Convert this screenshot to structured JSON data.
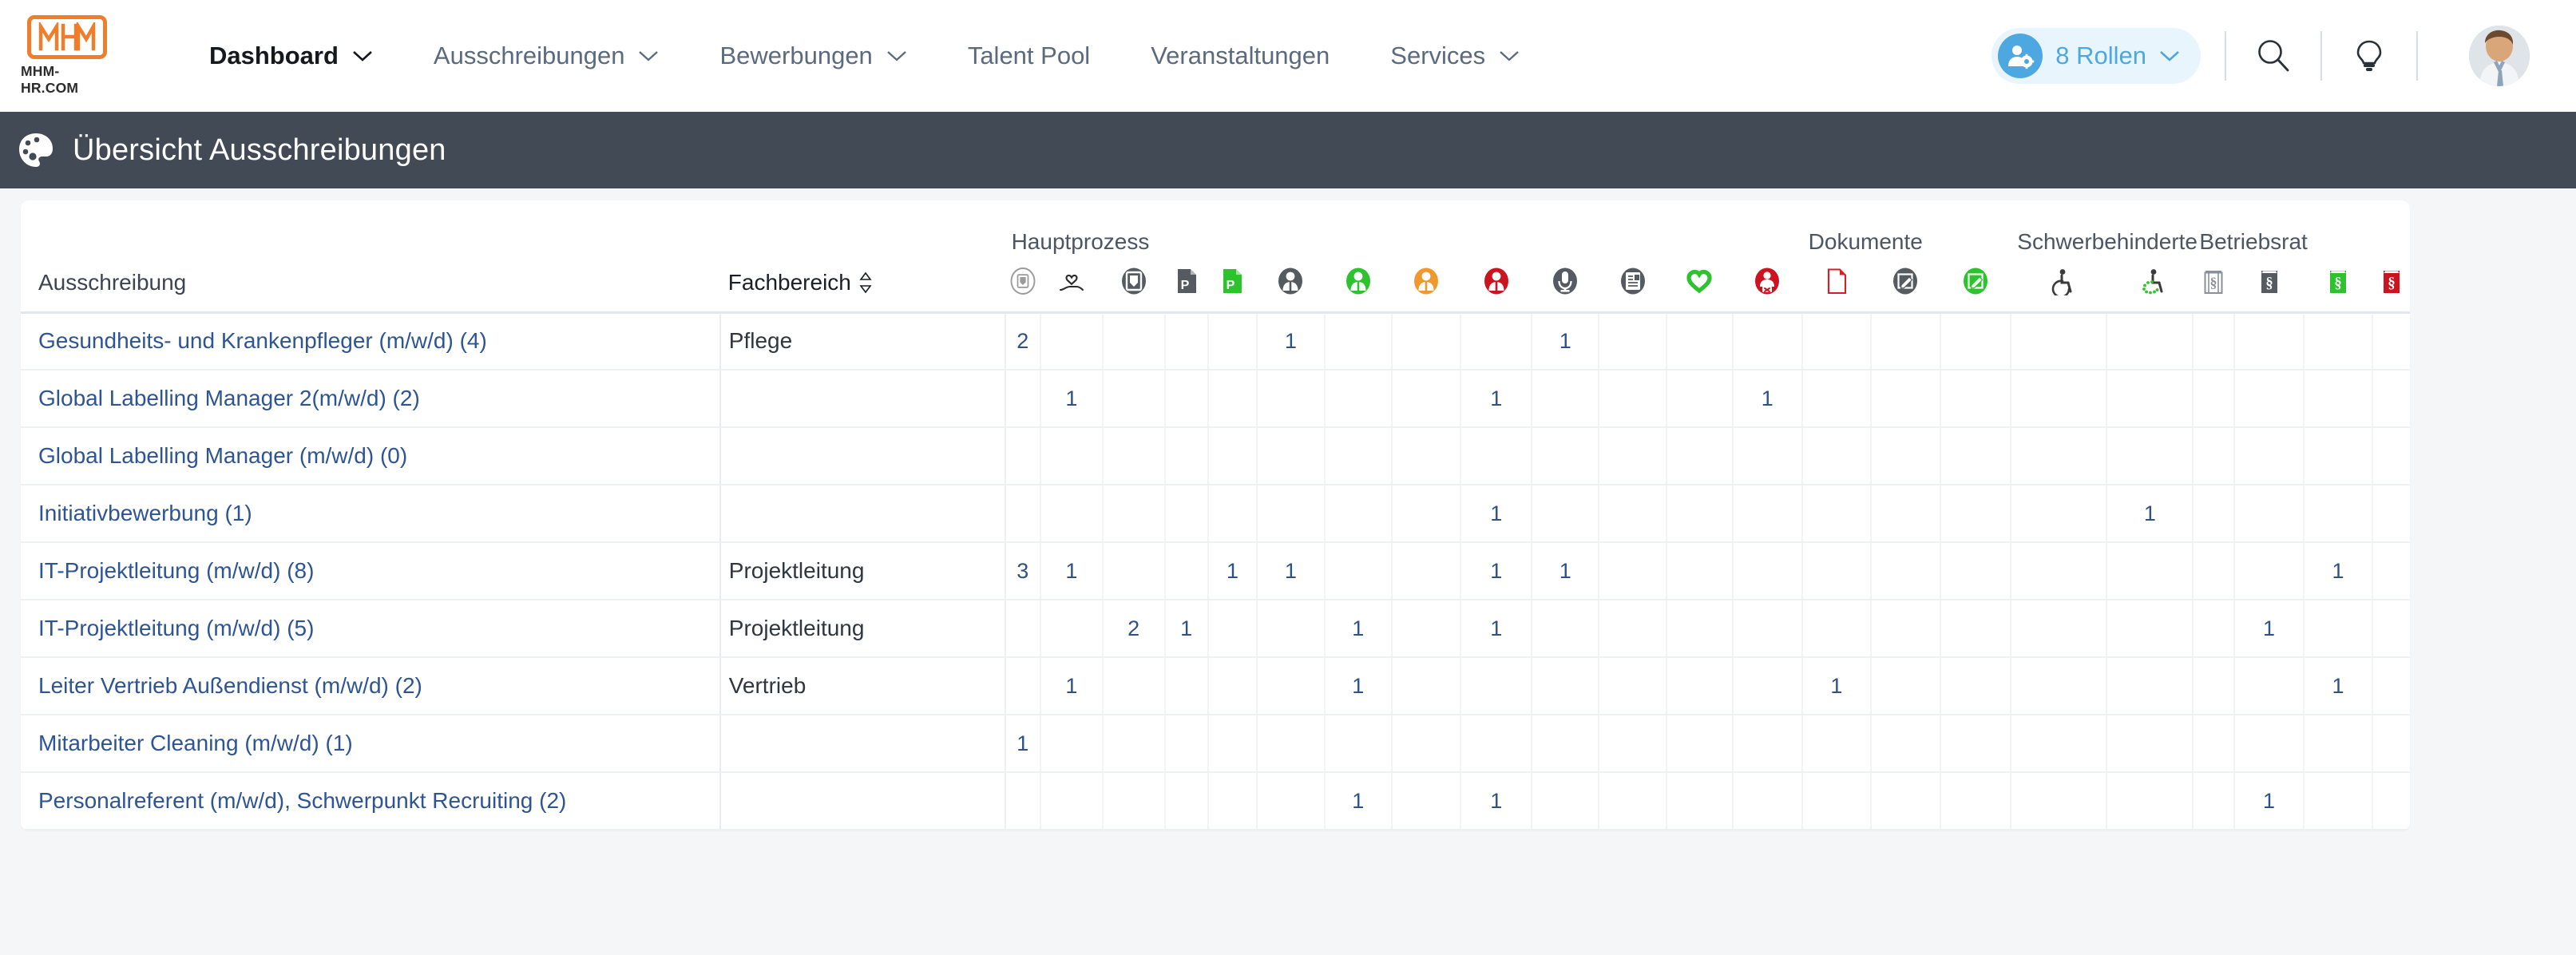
{
  "brand": {
    "logo_text": "MHM",
    "logo_subtitle": "MHM-HR.COM"
  },
  "nav": {
    "items": [
      {
        "label": "Dashboard",
        "has_chevron": true,
        "active": true
      },
      {
        "label": "Ausschreibungen",
        "has_chevron": true,
        "active": false
      },
      {
        "label": "Bewerbungen",
        "has_chevron": true,
        "active": false
      },
      {
        "label": "Talent Pool",
        "has_chevron": false,
        "active": false
      },
      {
        "label": "Veranstaltungen",
        "has_chevron": false,
        "active": false
      },
      {
        "label": "Services",
        "has_chevron": true,
        "active": false
      }
    ],
    "roles_pill": {
      "label": "8 Rollen",
      "icon": "user-roles-icon",
      "chevron": "chevron-down-icon"
    },
    "search_icon": "search-icon",
    "hint_icon": "lightbulb-icon",
    "avatar": "user-avatar"
  },
  "page": {
    "title": "Übersicht Ausschreibungen",
    "icon": "palette-icon"
  },
  "table": {
    "group_headers": [
      {
        "label": "Hauptprozess",
        "span": 13
      },
      {
        "label": "Dokumente",
        "span": 3
      },
      {
        "label": "Schwerbehinderte",
        "span": 2
      },
      {
        "label": "Betriebsrat",
        "span": 4
      }
    ],
    "col_headers": {
      "ausschreibung": "Ausschreibung",
      "fachbereich": "Fachbereich",
      "fachbereich_sort_icon": "sort-updown-icon"
    },
    "icon_columns": [
      {
        "name": "inbox-outline-icon",
        "glyph": "inbox",
        "style": "circle-outline",
        "color": "#9b9b9b"
      },
      {
        "name": "hand-heart-icon",
        "glyph": "handheart",
        "style": "plain",
        "color": "#2b2b2b"
      },
      {
        "name": "inbox-dark-icon",
        "glyph": "inbox",
        "style": "circle-fill",
        "color": "#555b60"
      },
      {
        "name": "pdf-dark-icon",
        "glyph": "docP",
        "style": "doc-fill",
        "color": "#555b60"
      },
      {
        "name": "pdf-green-icon",
        "glyph": "docP",
        "style": "doc-fill",
        "color": "#2fc22f"
      },
      {
        "name": "person-dark-icon",
        "glyph": "person",
        "style": "circle-fill",
        "color": "#555b60"
      },
      {
        "name": "person-green-icon",
        "glyph": "person",
        "style": "circle-fill",
        "color": "#2fc22f"
      },
      {
        "name": "person-orange-icon",
        "glyph": "person",
        "style": "circle-fill",
        "color": "#f0982f"
      },
      {
        "name": "person-red-icon",
        "glyph": "person",
        "style": "circle-fill",
        "color": "#cc1420"
      },
      {
        "name": "microphone-dark-icon",
        "glyph": "mic",
        "style": "circle-fill",
        "color": "#555b60"
      },
      {
        "name": "contract-dark-icon",
        "glyph": "contract",
        "style": "circle-fill",
        "color": "#555b60"
      },
      {
        "name": "heart-green-icon",
        "glyph": "heart",
        "style": "ring",
        "color": "#2fc22f"
      },
      {
        "name": "person-rejected-red-icon",
        "glyph": "personx",
        "style": "circle-fill",
        "color": "#cc1420"
      },
      {
        "name": "document-red-outline-icon",
        "glyph": "docblank",
        "style": "doc-outline",
        "color": "#d42027"
      },
      {
        "name": "edit-doc-dark-icon",
        "glyph": "editdoc",
        "style": "circle-fill",
        "color": "#555b60"
      },
      {
        "name": "edit-doc-green-icon",
        "glyph": "editdoc",
        "style": "circle-fill",
        "color": "#2fc22f"
      },
      {
        "name": "wheelchair-dark-icon",
        "glyph": "wheel",
        "style": "plain",
        "color": "#3b3b3b"
      },
      {
        "name": "wheelchair-green-icon",
        "glyph": "wheeldot",
        "style": "plain",
        "color": "#2fc22f"
      },
      {
        "name": "paragraph-book-outline-icon",
        "glyph": "book",
        "style": "book-outline",
        "color": "#8a9097"
      },
      {
        "name": "paragraph-book-dark-icon",
        "glyph": "book",
        "style": "book-fill",
        "color": "#555b60"
      },
      {
        "name": "paragraph-book-green-icon",
        "glyph": "book",
        "style": "book-fill",
        "color": "#2fc22f"
      },
      {
        "name": "paragraph-book-red-icon",
        "glyph": "book",
        "style": "book-fill",
        "color": "#cc1420"
      }
    ],
    "rows": [
      {
        "title": "Gesundheits- und Krankenpfleger (m/w/d) (4)",
        "fachbereich": "Pflege",
        "cells": [
          "2",
          "",
          "",
          "",
          "",
          "1",
          "",
          "",
          "",
          "1",
          "",
          "",
          "",
          "",
          "",
          "",
          "",
          "",
          "",
          "",
          "",
          ""
        ]
      },
      {
        "title": "Global Labelling Manager 2(m/w/d) (2)",
        "fachbereich": "",
        "cells": [
          "",
          "1",
          "",
          "",
          "",
          "",
          "",
          "",
          "1",
          "",
          "",
          "",
          "1",
          "",
          "",
          "",
          "",
          "",
          "",
          "",
          "",
          ""
        ]
      },
      {
        "title": "Global Labelling Manager (m/w/d) (0)",
        "fachbereich": "",
        "cells": [
          "",
          "",
          "",
          "",
          "",
          "",
          "",
          "",
          "",
          "",
          "",
          "",
          "",
          "",
          "",
          "",
          "",
          "",
          "",
          "",
          "",
          ""
        ]
      },
      {
        "title": "Initiativbewerbung (1)",
        "fachbereich": "",
        "cells": [
          "",
          "",
          "",
          "",
          "",
          "",
          "",
          "",
          "1",
          "",
          "",
          "",
          "",
          "",
          "",
          "",
          "",
          "1",
          "",
          "",
          "",
          ""
        ]
      },
      {
        "title": "IT-Projektleitung (m/w/d) (8)",
        "fachbereich": "Projektleitung",
        "cells": [
          "3",
          "1",
          "",
          "",
          "1",
          "1",
          "",
          "",
          "1",
          "1",
          "",
          "",
          "",
          "",
          "",
          "",
          "",
          "",
          "",
          "",
          "1",
          ""
        ]
      },
      {
        "title": "IT-Projektleitung (m/w/d) (5)",
        "fachbereich": "Projektleitung",
        "cells": [
          "",
          "",
          "2",
          "1",
          "",
          "",
          "1",
          "",
          "1",
          "",
          "",
          "",
          "",
          "",
          "",
          "",
          "",
          "",
          "",
          "1",
          "",
          ""
        ]
      },
      {
        "title": "Leiter Vertrieb Außendienst (m/w/d) (2)",
        "fachbereich": "Vertrieb",
        "cells": [
          "",
          "1",
          "",
          "",
          "",
          "",
          "1",
          "",
          "",
          "",
          "",
          "",
          "",
          "1",
          "",
          "",
          "",
          "",
          "",
          "",
          "1",
          ""
        ]
      },
      {
        "title": "Mitarbeiter Cleaning (m/w/d) (1)",
        "fachbereich": "",
        "cells": [
          "1",
          "",
          "",
          "",
          "",
          "",
          "",
          "",
          "",
          "",
          "",
          "",
          "",
          "",
          "",
          "",
          "",
          "",
          "",
          "",
          "",
          ""
        ]
      },
      {
        "title": "Personalreferent (m/w/d), Schwerpunkt Recruiting (2)",
        "fachbereich": "",
        "cells": [
          "",
          "",
          "",
          "",
          "",
          "",
          "1",
          "",
          "1",
          "",
          "",
          "",
          "",
          "",
          "",
          "",
          "",
          "",
          "",
          "1",
          "",
          ""
        ]
      }
    ]
  }
}
